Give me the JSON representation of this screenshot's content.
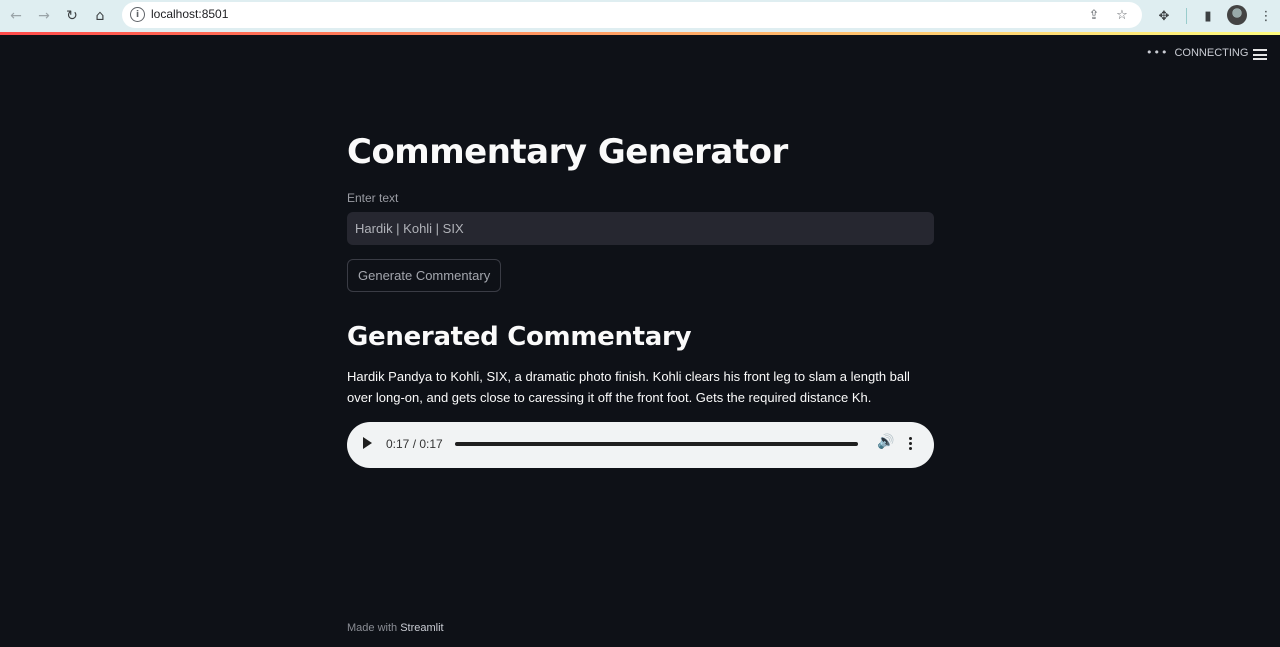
{
  "browser": {
    "url": "localhost:8501",
    "url_info_glyph": "i"
  },
  "streamlit_header": {
    "status_dots": "•••",
    "status_text": "CONNECTING"
  },
  "main": {
    "title": "Commentary Generator",
    "input_label": "Enter text",
    "input_value": "Hardik | Kohli | SIX",
    "button_label": "Generate Commentary",
    "output_heading": "Generated Commentary",
    "commentary_text": "Hardik Pandya to Kohli, SIX, a dramatic photo finish. Kohli clears his front leg to slam a length ball over long-on, and gets close to caressing it off the front foot. Gets the required distance Kh.",
    "audio": {
      "time_display": "0:17 / 0:17",
      "progress": 1.0
    }
  },
  "footer": {
    "prefix": "Made with",
    "brand": "Streamlit"
  },
  "colors": {
    "background": "#0e1117",
    "input_bg": "#262730",
    "accent_line_start": "#ff4b4b",
    "accent_line_end": "#fffd80"
  }
}
